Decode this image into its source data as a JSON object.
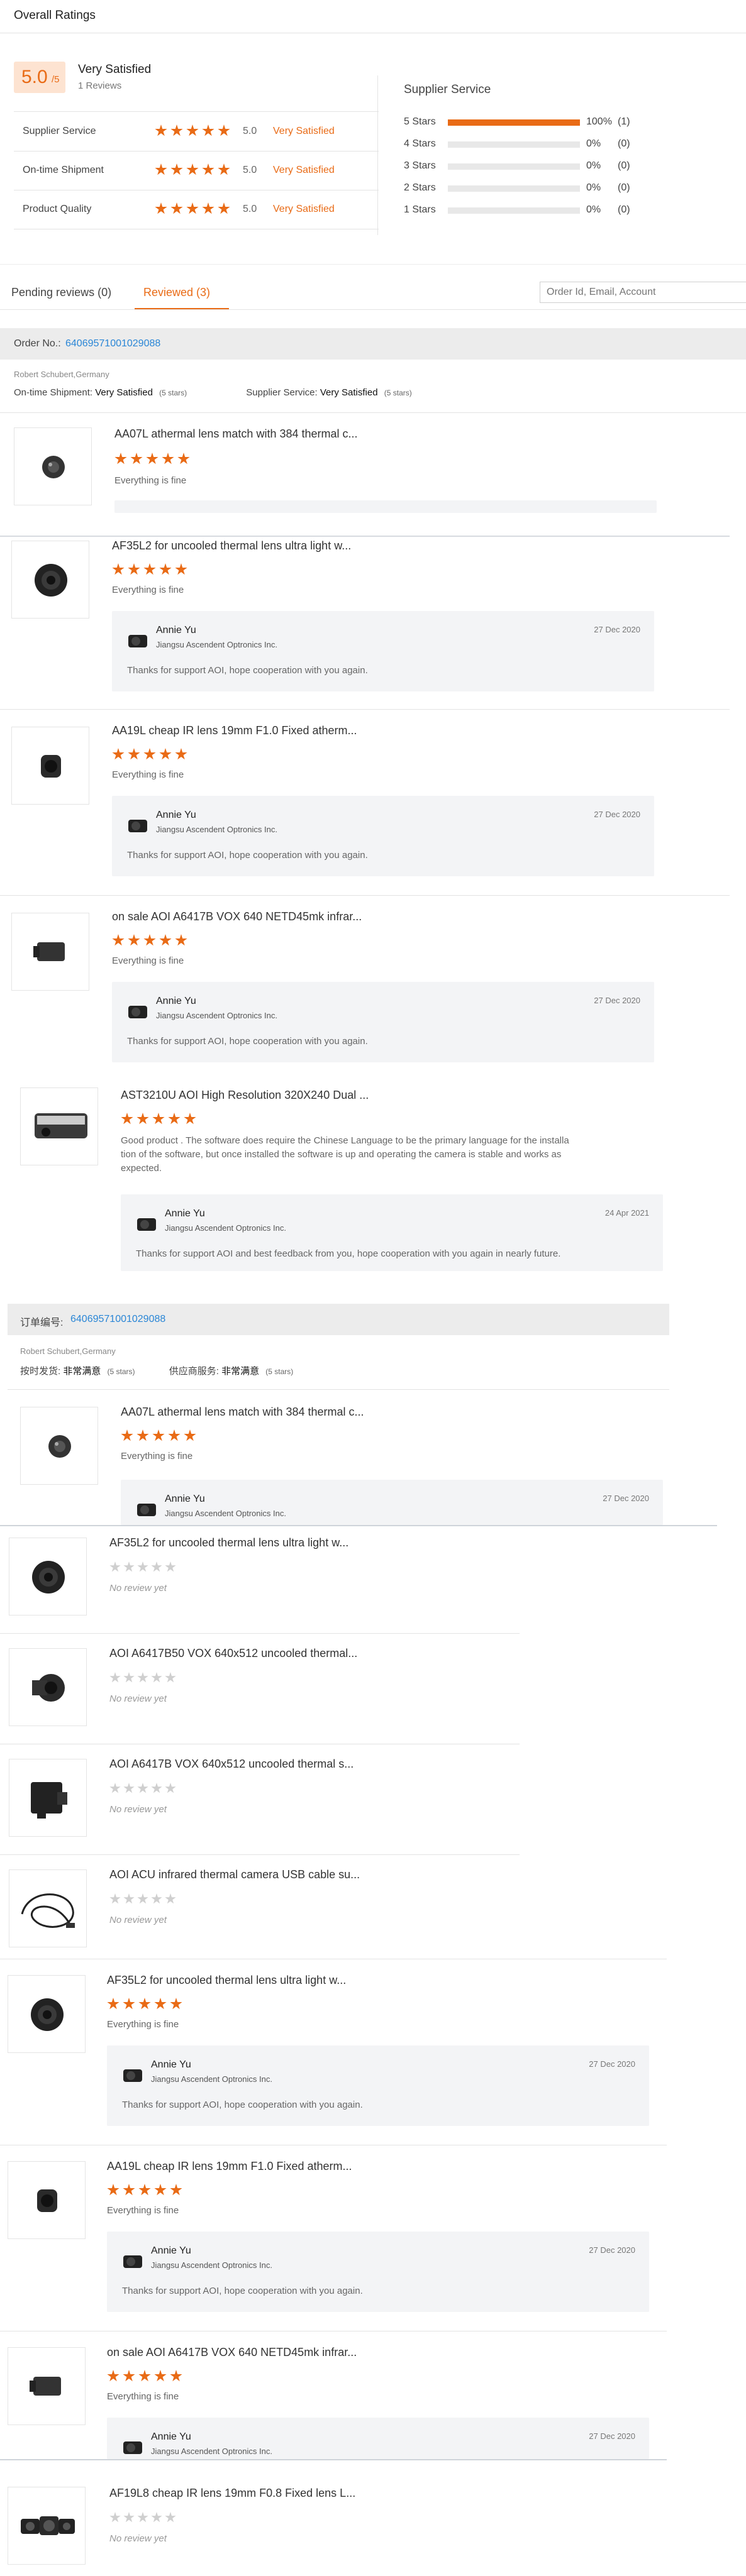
{
  "ratings": {
    "heading": "Overall Ratings",
    "score": "5.0",
    "score_suffix": "/5",
    "satisfaction": "Very Satisfied",
    "reviews_count": "1 Reviews",
    "rows": [
      {
        "label": "Supplier Service",
        "value": "5.0",
        "status": "Very Satisfied"
      },
      {
        "label": "On-time Shipment",
        "value": "5.0",
        "status": "Very Satisfied"
      },
      {
        "label": "Product Quality",
        "value": "5.0",
        "status": "Very Satisfied"
      }
    ],
    "breakdown_title": "Supplier Service",
    "breakdown": [
      {
        "label": "5 Stars",
        "fraction": 1.0,
        "percent": "100%",
        "count": "(1)"
      },
      {
        "label": "4 Stars",
        "fraction": 0,
        "percent": "0%",
        "count": "(0)"
      },
      {
        "label": "3 Stars",
        "fraction": 0,
        "percent": "0%",
        "count": "(0)"
      },
      {
        "label": "2 Stars",
        "fraction": 0,
        "percent": "0%",
        "count": "(0)"
      },
      {
        "label": "1 Stars",
        "fraction": 0,
        "percent": "0%",
        "count": "(0)"
      }
    ]
  },
  "tabs": {
    "pending": "Pending reviews (0)",
    "reviewed": "Reviewed (3)",
    "search_placeholder": "Order Id, Email, Account"
  },
  "order1": {
    "label": "Order No.:",
    "number": "64069571001029088",
    "buyer": "Robert Schubert,Germany",
    "shipment_label": "On-time Shipment:",
    "shipment_value": "Very Satisfied",
    "shipment_stars": "(5 stars)",
    "service_label": "Supplier Service:",
    "service_value": "Very Satisfied",
    "service_stars": "(5 stars)"
  },
  "order2": {
    "label": "订单编号:",
    "number": "64069571001029088",
    "buyer": "Robert Schubert,Germany",
    "shipment_label": "按时发货:",
    "shipment_value": "非常满意",
    "shipment_stars": "(5 stars)",
    "service_label": "供应商服务:",
    "service_value": "非常满意",
    "service_stars": "(5 stars)"
  },
  "reply": {
    "name": "Annie Yu",
    "company": "Jiangsu Ascendent Optronics Inc."
  },
  "reviews": [
    {
      "name": "AA07L athermal lens match with 384 thermal c...",
      "rating": 5,
      "text": "Everything is fine"
    },
    {
      "name": "AF35L2 for uncooled thermal lens ultra light w...",
      "rating": 5,
      "text": "Everything is fine",
      "reply_date": "27 Dec 2020",
      "reply_text": "Thanks for support AOI, hope cooperation with you again."
    },
    {
      "name": "AA19L cheap IR lens 19mm F1.0 Fixed atherm...",
      "rating": 5,
      "text": "Everything is fine",
      "reply_date": "27 Dec 2020",
      "reply_text": "Thanks for support AOI, hope cooperation with you again."
    },
    {
      "name": "on sale AOI A6417B VOX 640 NETD45mk infrar...",
      "rating": 5,
      "text": "Everything is fine",
      "reply_date": "27 Dec 2020",
      "reply_text": "Thanks for support AOI, hope cooperation with you again."
    },
    {
      "name": "AST3210U AOI High Resolution 320X240 Dual ...",
      "rating": 5,
      "text_line1": "Good product . The software does require the Chinese Language to be the primary language for the installa",
      "text_line2": "tion of the software, but once installed the software is up and operating the camera is stable and works as",
      "text_line3": "expected.",
      "reply_date": "24 Apr 2021",
      "reply_text": "Thanks for support AOI and best feedback from you, hope cooperation with you again in nearly future."
    },
    {
      "name": "AA07L athermal lens match with 384 thermal c...",
      "rating": 5,
      "text": "Everything is fine",
      "reply_date": "27 Dec 2020"
    },
    {
      "name": "AF35L2 for uncooled thermal lens ultra light w...",
      "rating": 0,
      "text": "No review yet"
    },
    {
      "name": "AOI A6417B50 VOX 640x512 uncooled thermal...",
      "rating": 0,
      "text": "No review yet"
    },
    {
      "name": "AOI A6417B VOX 640x512 uncooled thermal s...",
      "rating": 0,
      "text": "No review yet"
    },
    {
      "name": "AOI ACU infrared thermal camera USB cable su...",
      "rating": 0,
      "text": "No review yet"
    },
    {
      "name": "AF35L2 for uncooled thermal lens ultra light w...",
      "rating": 5,
      "text": "Everything is fine",
      "reply_date": "27 Dec 2020",
      "reply_text": "Thanks for support AOI, hope cooperation with you again."
    },
    {
      "name": "AA19L cheap IR lens 19mm F1.0 Fixed atherm...",
      "rating": 5,
      "text": "Everything is fine",
      "reply_date": "27 Dec 2020",
      "reply_text": "Thanks for support AOI, hope cooperation with you again."
    },
    {
      "name": "on sale AOI A6417B VOX 640 NETD45mk infrar...",
      "rating": 5,
      "text": "Everything is fine",
      "reply_date": "27 Dec 2020"
    },
    {
      "name": "AF19L8 cheap IR lens 19mm F0.8 Fixed lens L...",
      "rating": 0,
      "text": "No review yet"
    }
  ]
}
